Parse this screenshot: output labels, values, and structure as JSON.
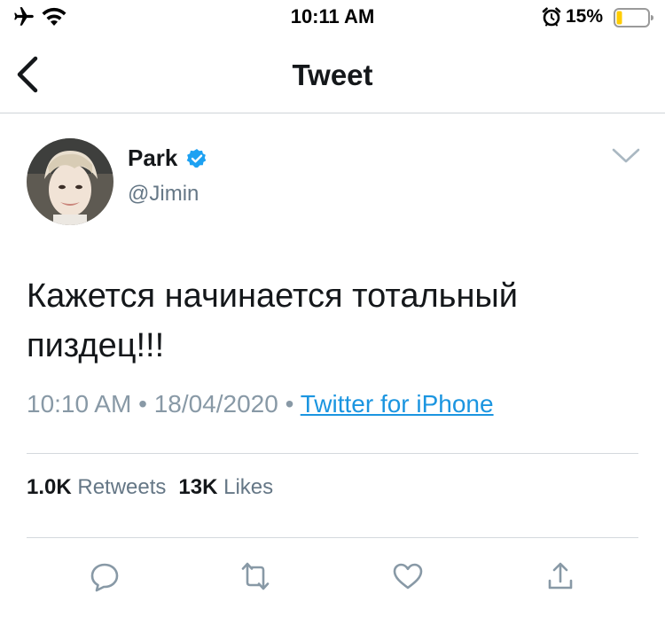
{
  "status_bar": {
    "time": "10:11 AM",
    "battery_percent": "15%",
    "battery_level": 0.15,
    "icons": [
      "airplane-icon",
      "wifi-icon",
      "alarm-icon",
      "battery-icon"
    ],
    "battery_color": "#ffcc00"
  },
  "nav": {
    "title": "Tweet",
    "back_icon": "chevron-left-icon"
  },
  "tweet": {
    "author_name": "Park",
    "author_handle": "@Jimin",
    "verified": true,
    "text_line1": "Кажется начинается тотальный",
    "text_line2": "пиздец!!!",
    "time": "10:10 AM",
    "separator": "•",
    "date": "18/04/2020",
    "source": "Twitter for iPhone"
  },
  "stats": {
    "retweets_count": "1.0K",
    "retweets_label": "Retweets",
    "likes_count": "13K",
    "likes_label": "Likes"
  },
  "actions": [
    "reply-icon",
    "retweet-icon",
    "like-icon",
    "share-icon"
  ],
  "colors": {
    "link": "#1b95e0",
    "verified": "#1da1f2",
    "secondary_text": "#657786",
    "icon_gray": "#8899a6"
  }
}
